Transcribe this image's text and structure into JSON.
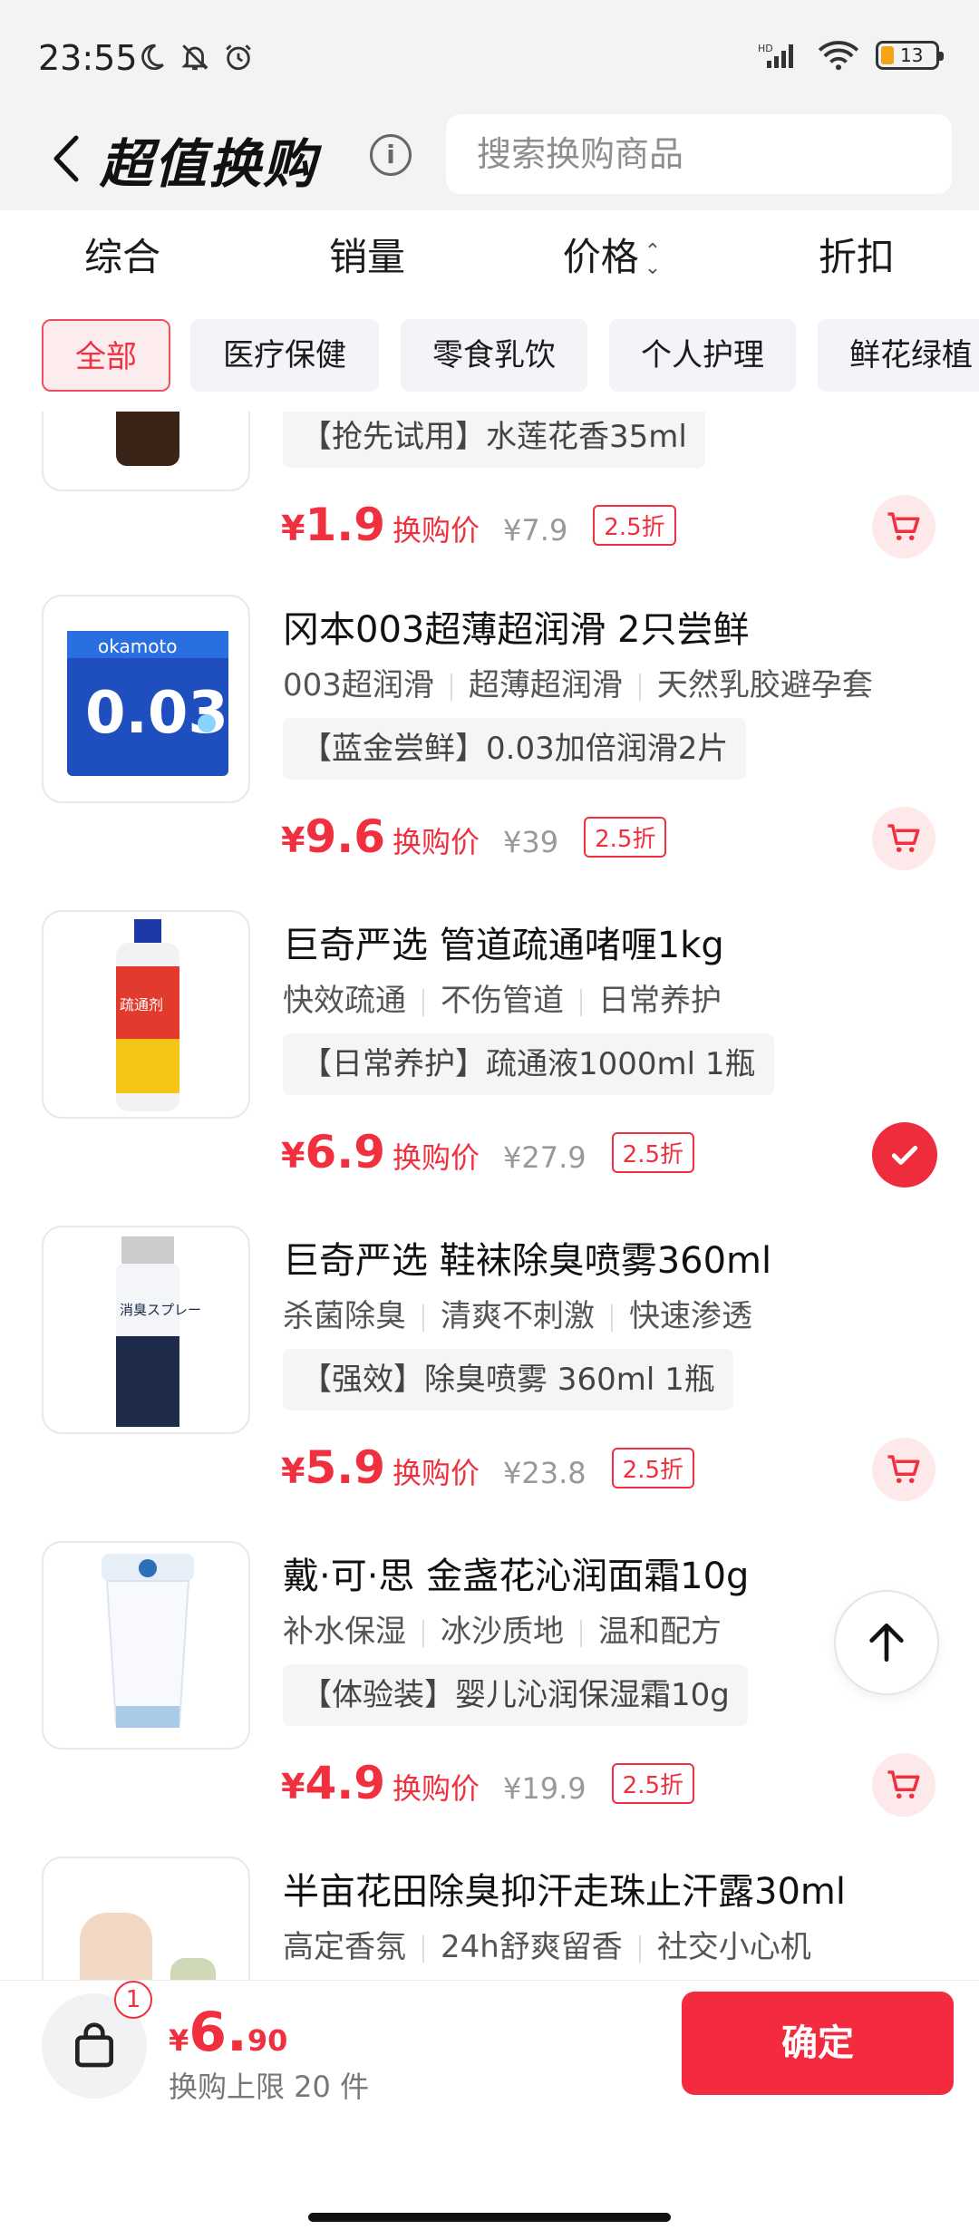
{
  "status_bar": {
    "time": "23:55",
    "battery": "13"
  },
  "header": {
    "title": "超值换购",
    "search_placeholder": "搜索换购商品"
  },
  "sort_tabs": [
    "综合",
    "销量",
    "价格",
    "折扣"
  ],
  "categories": [
    "全部",
    "医疗保健",
    "零食乳饮",
    "个人护理",
    "鲜花绿植"
  ],
  "products": [
    {
      "name": "",
      "tags": [],
      "spec": "【抢先试用】水莲花香35ml",
      "price_int": "1.9",
      "price_label": "换购价",
      "orig_price": "¥7.9",
      "discount": "2.5折",
      "selected": false
    },
    {
      "name": "冈本003超薄超润滑 2只尝鲜",
      "tags": [
        "003超润滑",
        "超薄超润滑",
        "天然乳胶避孕套"
      ],
      "spec": "【蓝金尝鲜】0.03加倍润滑2片",
      "price_int": "9.6",
      "price_label": "换购价",
      "orig_price": "¥39",
      "discount": "2.5折",
      "selected": false
    },
    {
      "name": "巨奇严选 管道疏通啫喱1kg",
      "tags": [
        "快效疏通",
        "不伤管道",
        "日常养护"
      ],
      "spec": "【日常养护】疏通液1000ml 1瓶",
      "price_int": "6.9",
      "price_label": "换购价",
      "orig_price": "¥27.9",
      "discount": "2.5折",
      "selected": true
    },
    {
      "name": "巨奇严选 鞋袜除臭喷雾360ml",
      "tags": [
        "杀菌除臭",
        "清爽不刺激",
        "快速渗透"
      ],
      "spec": "【强效】除臭喷雾 360ml 1瓶",
      "price_int": "5.9",
      "price_label": "换购价",
      "orig_price": "¥23.8",
      "discount": "2.5折",
      "selected": false
    },
    {
      "name": "戴·可·思 金盏花沁润面霜10g",
      "tags": [
        "补水保湿",
        "冰沙质地",
        "温和配方"
      ],
      "spec": "【体验装】婴儿沁润保湿霜10g",
      "price_int": "4.9",
      "price_label": "换购价",
      "orig_price": "¥19.9",
      "discount": "2.5折",
      "selected": false
    },
    {
      "name": "半亩花田除臭抑汗走珠止汗露30ml",
      "tags": [
        "高定香氛",
        "24h舒爽留香",
        "社交小心机"
      ],
      "spec": "",
      "price_int": "",
      "price_label": "",
      "orig_price": "",
      "discount": "",
      "selected": false
    }
  ],
  "bottom": {
    "cart_count": "1",
    "yen": "¥",
    "total_int": "6.",
    "total_dec": "90",
    "limit_text": "换购上限 20 件",
    "confirm_label": "确定"
  },
  "colors": {
    "accent": "#f1303f",
    "header_bg": "#f2f3f5"
  }
}
